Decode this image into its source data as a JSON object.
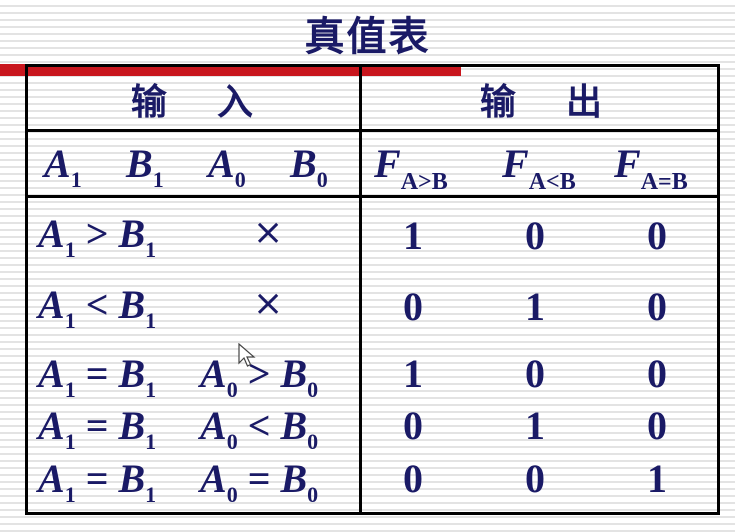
{
  "title": "真值表",
  "header": {
    "input": "输    入",
    "output": "输    出"
  },
  "columns": {
    "inputs": [
      {
        "v": "A",
        "s": "1"
      },
      {
        "v": "B",
        "s": "1"
      },
      {
        "v": "A",
        "s": "0"
      },
      {
        "v": "B",
        "s": "0"
      }
    ],
    "outputs": [
      {
        "v": "F",
        "s": "A>B"
      },
      {
        "v": "F",
        "s": "A<B"
      },
      {
        "v": "F",
        "s": "A=B"
      }
    ]
  },
  "rows": [
    {
      "cond1": {
        "l": "A",
        "ls": "1",
        "op": " > ",
        "r": "B",
        "rs": "1"
      },
      "cond2": "×",
      "out": [
        "1",
        "0",
        "0"
      ]
    },
    {
      "cond1": {
        "l": "A",
        "ls": "1",
        "op": " < ",
        "r": "B",
        "rs": "1"
      },
      "cond2": "×",
      "out": [
        "0",
        "1",
        "0"
      ]
    },
    {
      "cond1": {
        "l": "A",
        "ls": "1",
        "op": " = ",
        "r": "B",
        "rs": "1"
      },
      "cond2": {
        "l": "A",
        "ls": "0",
        "op": " > ",
        "r": "B",
        "rs": "0"
      },
      "out": [
        "1",
        "0",
        "0"
      ]
    },
    {
      "cond1": {
        "l": "A",
        "ls": "1",
        "op": " = ",
        "r": "B",
        "rs": "1"
      },
      "cond2": {
        "l": "A",
        "ls": "0",
        "op": " < ",
        "r": "B",
        "rs": "0"
      },
      "out": [
        "0",
        "1",
        "0"
      ]
    },
    {
      "cond1": {
        "l": "A",
        "ls": "1",
        "op": " = ",
        "r": "B",
        "rs": "1"
      },
      "cond2": {
        "l": "A",
        "ls": "0",
        "op": " = ",
        "r": "B",
        "rs": "0"
      },
      "out": [
        "0",
        "0",
        "1"
      ]
    }
  ],
  "colors": {
    "text": "#1a1a66",
    "accent": "#c8161d"
  },
  "icons": {
    "cursor": "mouse-pointer-icon"
  }
}
